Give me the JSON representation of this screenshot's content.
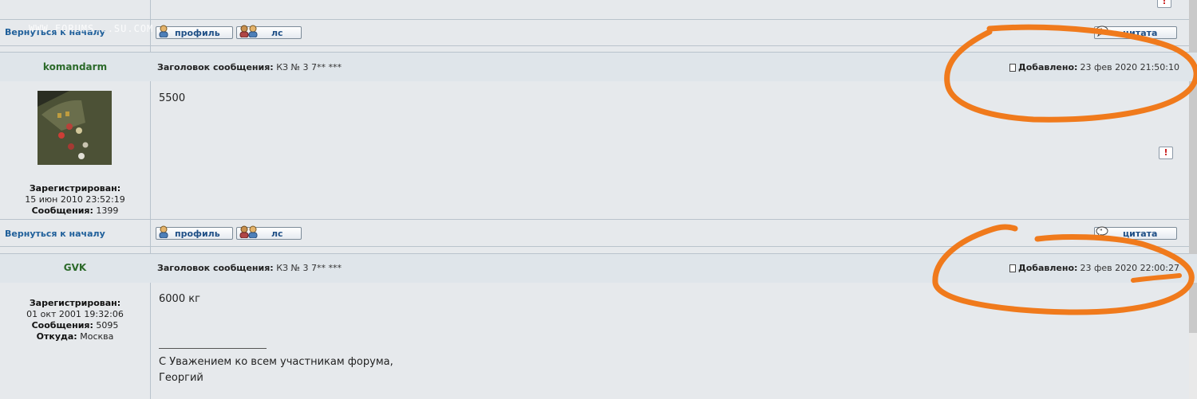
{
  "watermark": "WWW.FORUMS...SU.COM",
  "back_to_top": "Вернуться к началу",
  "buttons": {
    "profile": "профиль",
    "pm": "лс",
    "quote": "цитата"
  },
  "labels": {
    "subject": "Заголовок сообщения:",
    "posted": "Добавлено:",
    "registered": "Зарегистрирован:",
    "posts": "Сообщения:",
    "from": "Откуда:"
  },
  "posts": [
    {
      "username": "komandarm",
      "subject": "КЗ № 3 7** ***",
      "posted_at": "23 фев 2020 21:50:10",
      "registered_at": "15 июн 2010 23:52:19",
      "post_count": "1399",
      "body": "5500"
    },
    {
      "username": "GVK",
      "subject": "КЗ № 3 7** ***",
      "posted_at": "23 фев 2020 22:00:27",
      "registered_at": "01 окт 2001 19:32:06",
      "post_count": "5095",
      "location": "Москва",
      "body": "6000 кг",
      "signature": [
        "С Уважением ко всем участникам форума,",
        "Георгий"
      ]
    }
  ],
  "colors": {
    "annotation": "#f07a1c",
    "username": "#2c6a2a",
    "link": "#1f5f9a"
  }
}
